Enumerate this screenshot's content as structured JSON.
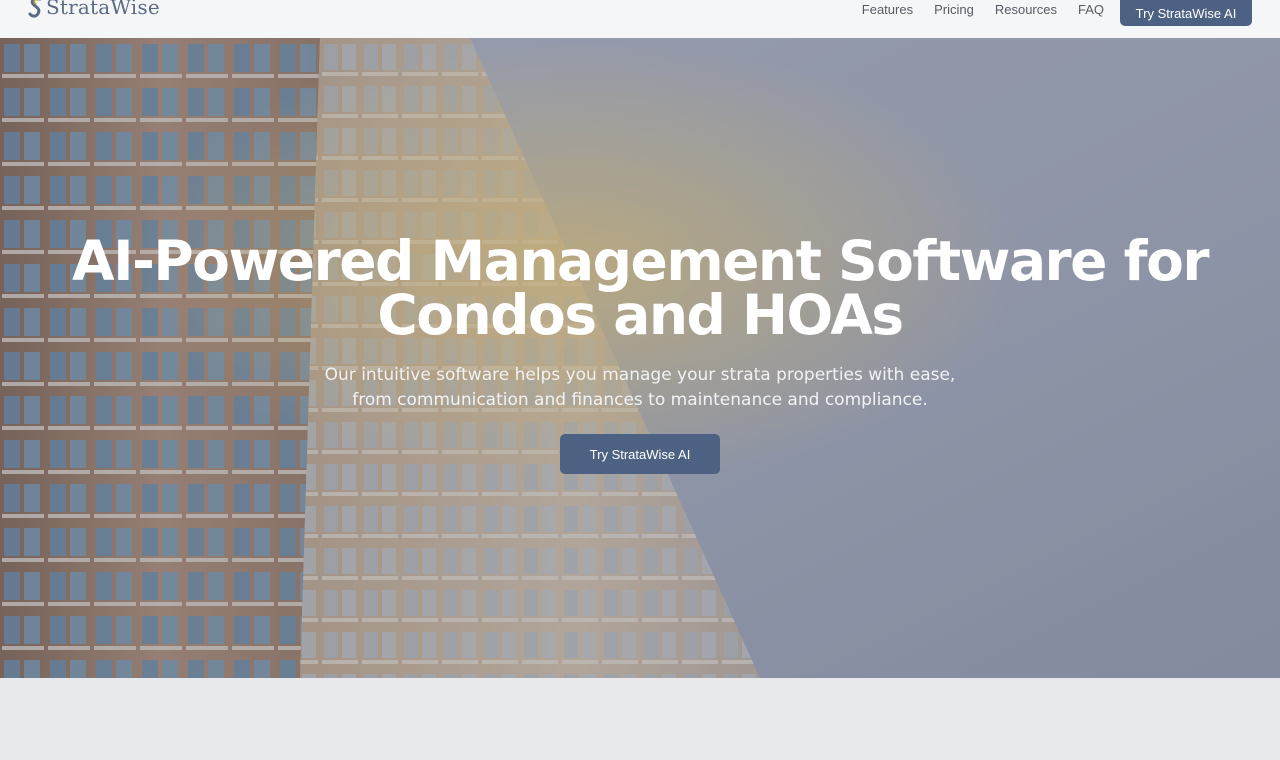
{
  "nav": {
    "brand": "StrataWise",
    "links": [
      "Features",
      "Pricing",
      "Resources",
      "FAQ"
    ],
    "cta": "Try StrataWise AI"
  },
  "hero": {
    "title_line1": "AI-Powered Management Software for",
    "title_line2": "Condos and HOAs",
    "subtitle_line1": "Our intuitive software helps you manage your strata properties with ease,",
    "subtitle_line2": "from communication and finances to maintenance and compliance.",
    "cta": "Try StrataWise AI",
    "image": "condo-building-photo"
  },
  "colors": {
    "accent": "#4d6282",
    "nav_bg": "#f5f6f8",
    "page_bg": "#e8e9ec",
    "logo": "#5b6b82"
  }
}
